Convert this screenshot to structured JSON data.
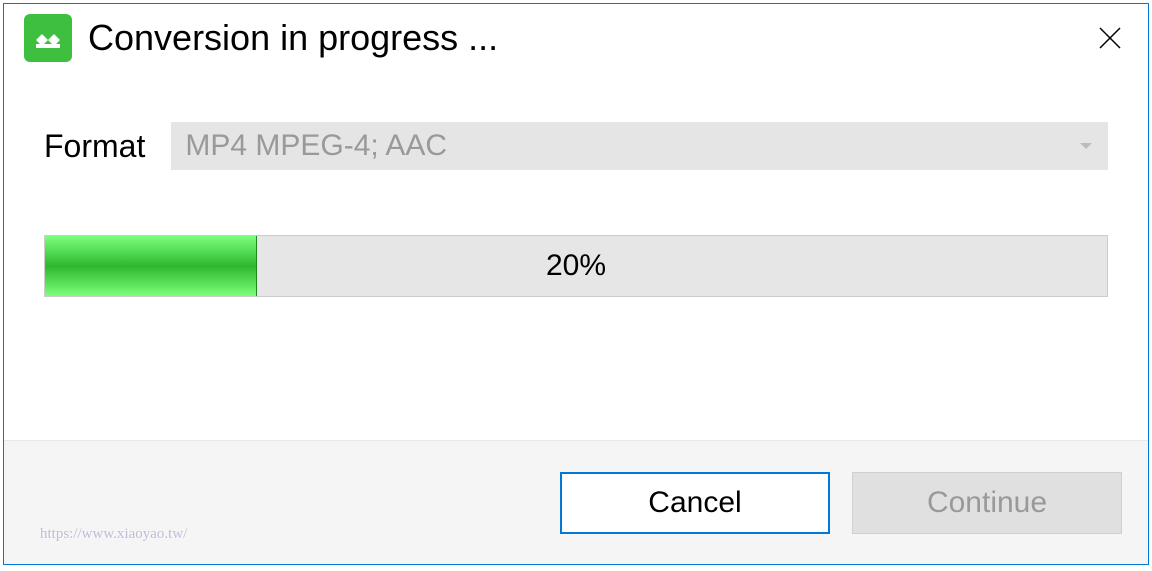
{
  "title": "Conversion in progress ...",
  "format": {
    "label": "Format",
    "selected": "MP4 MPEG-4; AAC"
  },
  "progress": {
    "percent": 20,
    "text": "20%"
  },
  "buttons": {
    "cancel": "Cancel",
    "continue": "Continue"
  },
  "watermark": "https://www.xiaoyao.tw/"
}
